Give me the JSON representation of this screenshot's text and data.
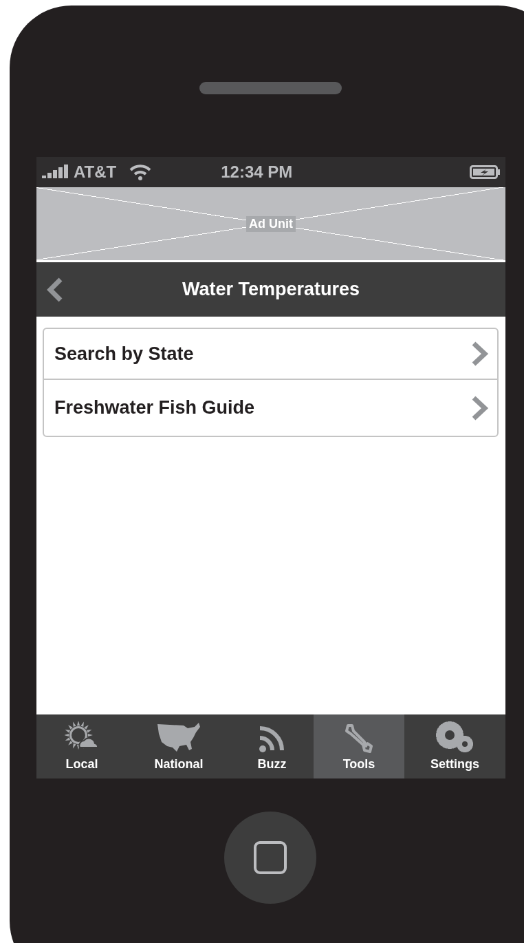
{
  "status_bar": {
    "carrier": "AT&T",
    "time": "12:34 PM"
  },
  "ad": {
    "label": "Ad Unit"
  },
  "nav_bar": {
    "title": "Water Temperatures"
  },
  "list": [
    {
      "label": "Search by State"
    },
    {
      "label": "Freshwater Fish Guide"
    }
  ],
  "tab_bar": [
    {
      "label": "Local",
      "selected": false
    },
    {
      "label": "National",
      "selected": false
    },
    {
      "label": "Buzz",
      "selected": false
    },
    {
      "label": "Tools",
      "selected": true
    },
    {
      "label": "Settings",
      "selected": false
    }
  ]
}
